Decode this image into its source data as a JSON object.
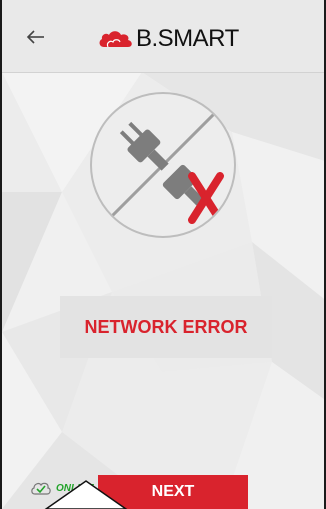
{
  "header": {
    "back_icon": "arrow-left-icon",
    "logo_text": "B.SMART",
    "logo_icon": "cloud-logo-icon",
    "brand_color": "#d9232d"
  },
  "main": {
    "illustration_icon": "unplugged-plug-icon",
    "error_mark_icon": "red-x-icon",
    "error_message": "NETWORK ERROR"
  },
  "footer": {
    "status_icon": "cloud-check-icon",
    "status_label": "ONLINE",
    "status_color": "#22a32a",
    "next_label": "NEXT"
  }
}
